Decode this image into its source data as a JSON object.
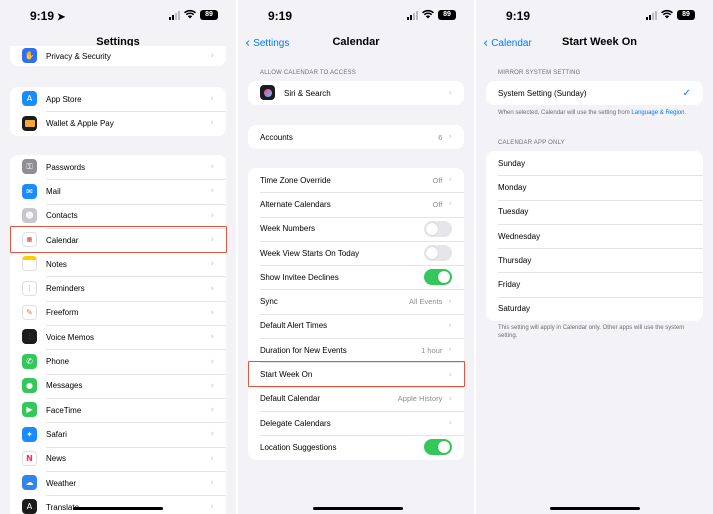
{
  "status": {
    "time": "9:19",
    "battery": "89"
  },
  "settings": {
    "title": "Settings",
    "partial_top": "Privacy & Security",
    "group_store": [
      "App Store",
      "Wallet & Apple Pay"
    ],
    "apps": [
      "Passwords",
      "Mail",
      "Contacts",
      "Calendar",
      "Notes",
      "Reminders",
      "Freeform",
      "Voice Memos",
      "Phone",
      "Messages",
      "FaceTime",
      "Safari",
      "News",
      "Weather",
      "Translate"
    ]
  },
  "calendar": {
    "back": "Settings",
    "title": "Calendar",
    "access_header": "ALLOW CALENDAR TO ACCESS",
    "siri": "Siri & Search",
    "accounts_label": "Accounts",
    "accounts_value": "6",
    "rows": {
      "tz_label": "Time Zone Override",
      "tz_value": "Off",
      "alt_label": "Alternate Calendars",
      "alt_value": "Off",
      "weeknum_label": "Week Numbers",
      "weekview_label": "Week View Starts On Today",
      "invitee_label": "Show Invitee Declines",
      "sync_label": "Sync",
      "sync_value": "All Events",
      "alert_label": "Default Alert Times",
      "duration_label": "Duration for New Events",
      "duration_value": "1 hour",
      "startweek_label": "Start Week On",
      "defcal_label": "Default Calendar",
      "defcal_value": "Apple History",
      "delegate_label": "Delegate Calendars",
      "location_label": "Location Suggestions"
    },
    "toggles": {
      "week_numbers": false,
      "week_view_today": false,
      "invitee_declines": true,
      "location_suggestions": true
    }
  },
  "startweek": {
    "back": "Calendar",
    "title": "Start Week On",
    "mirror_header": "MIRROR SYSTEM SETTING",
    "system_setting": "System Setting (Sunday)",
    "mirror_note_prefix": "When selected, Calendar will use the setting from ",
    "mirror_note_link": "Language & Region",
    "mirror_note_suffix": ".",
    "app_header": "CALENDAR APP ONLY",
    "days": [
      "Sunday",
      "Monday",
      "Tuesday",
      "Wednesday",
      "Thursday",
      "Friday",
      "Saturday"
    ],
    "footer_note": "This setting will apply in Calendar only. Other apps will use the system setting."
  },
  "colors": {
    "accent": "#007aff",
    "toggle_on": "#34c759",
    "highlight": "#e2553e"
  },
  "icons": {
    "privacy": "hand-icon",
    "app_store": "app-store-icon",
    "wallet": "wallet-icon",
    "passwords": "key-icon",
    "mail": "envelope-icon",
    "contacts": "contacts-icon",
    "calendar": "calendar-icon",
    "notes": "notes-icon",
    "reminders": "reminders-icon",
    "freeform": "freeform-icon",
    "voice_memos": "waveform-icon",
    "phone": "phone-icon",
    "messages": "speech-bubble-icon",
    "facetime": "video-camera-icon",
    "safari": "compass-icon",
    "news": "news-icon",
    "weather": "weather-icon",
    "translate": "translate-icon",
    "siri": "siri-icon"
  }
}
